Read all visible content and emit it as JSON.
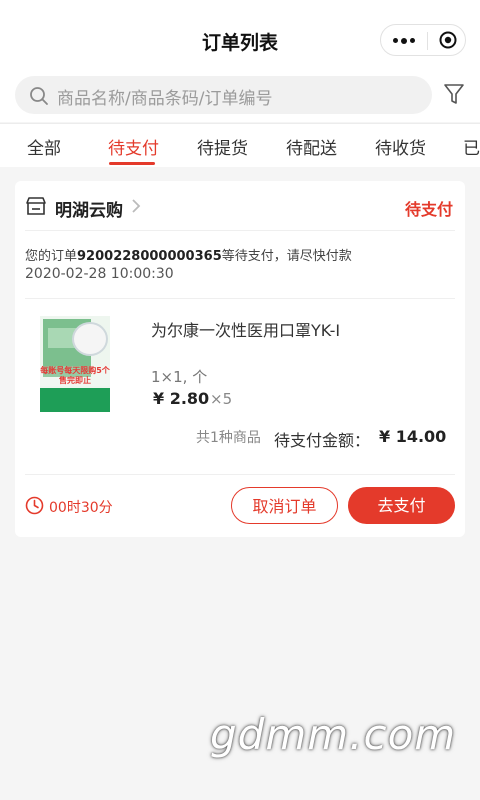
{
  "header": {
    "title": "订单列表"
  },
  "search": {
    "placeholder": "商品名称/商品条码/订单编号"
  },
  "tabs": [
    {
      "label": "全部"
    },
    {
      "label": "待支付",
      "active": true
    },
    {
      "label": "待提货"
    },
    {
      "label": "待配送"
    },
    {
      "label": "待收货"
    },
    {
      "label": "已"
    }
  ],
  "order": {
    "store_name": "明湖云购",
    "status": "待支付",
    "notice_prefix": "您的订单",
    "order_no": "9200228000000365",
    "notice_suffix": "等待支付，请尽快付款",
    "time": "2020-02-28 10:00:30",
    "item": {
      "name": "为尔康一次性医用口罩YK-I",
      "spec": "1×1, 个",
      "price": "¥ 2.80",
      "qty": "×5",
      "image_text": "每账号每天限购5个 售完即止"
    },
    "count_text": "共1种商品",
    "amount_label": "待支付金额：",
    "amount": "¥ 14.00",
    "countdown": "00时30分",
    "cancel_label": "取消订单",
    "pay_label": "去支付"
  },
  "watermark": "gdmm.com",
  "colors": {
    "accent": "#e43a2b",
    "background": "#f5f5f5"
  }
}
